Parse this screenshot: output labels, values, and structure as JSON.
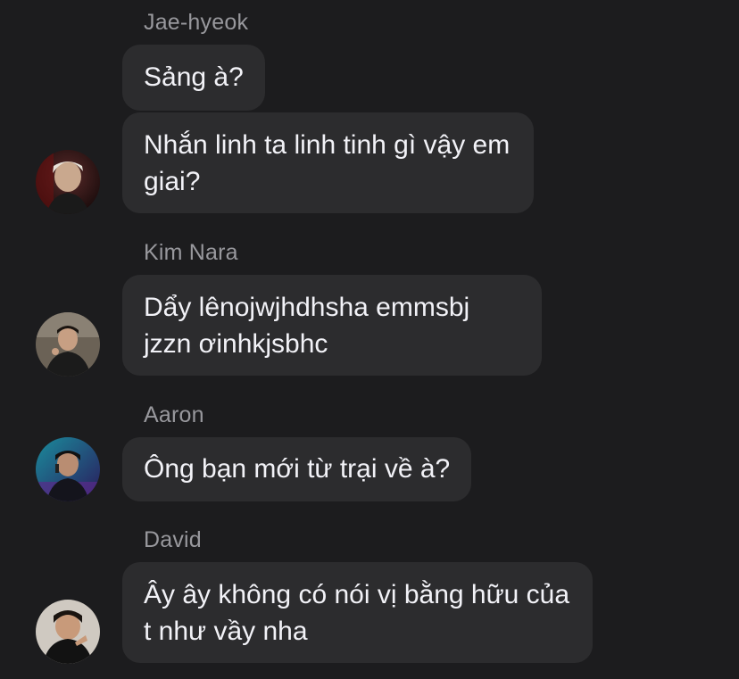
{
  "conversation": [
    {
      "sender": "Jae-hyeok",
      "avatar_icon": "user-avatar-photo",
      "messages": [
        "Sảng à?",
        "Nhắn linh ta linh tinh gì vậy em giai?"
      ]
    },
    {
      "sender": "Kim Nara",
      "avatar_icon": "user-avatar-photo",
      "messages": [
        "Dẩy lênojwjhdhsha emmsbj jzzn ơinhkjsbhc"
      ]
    },
    {
      "sender": "Aaron",
      "avatar_icon": "user-avatar-photo",
      "messages": [
        "Ông bạn mới từ trại về à?"
      ]
    },
    {
      "sender": "David",
      "avatar_icon": "user-avatar-photo",
      "messages": [
        "Ây ây không có nói vị bằng hữu của t như vầy nha"
      ]
    }
  ],
  "colors": {
    "background": "#1c1c1e",
    "bubble": "#2c2c2e",
    "message_text": "#f2f2f7",
    "sender_text": "#98989d"
  }
}
